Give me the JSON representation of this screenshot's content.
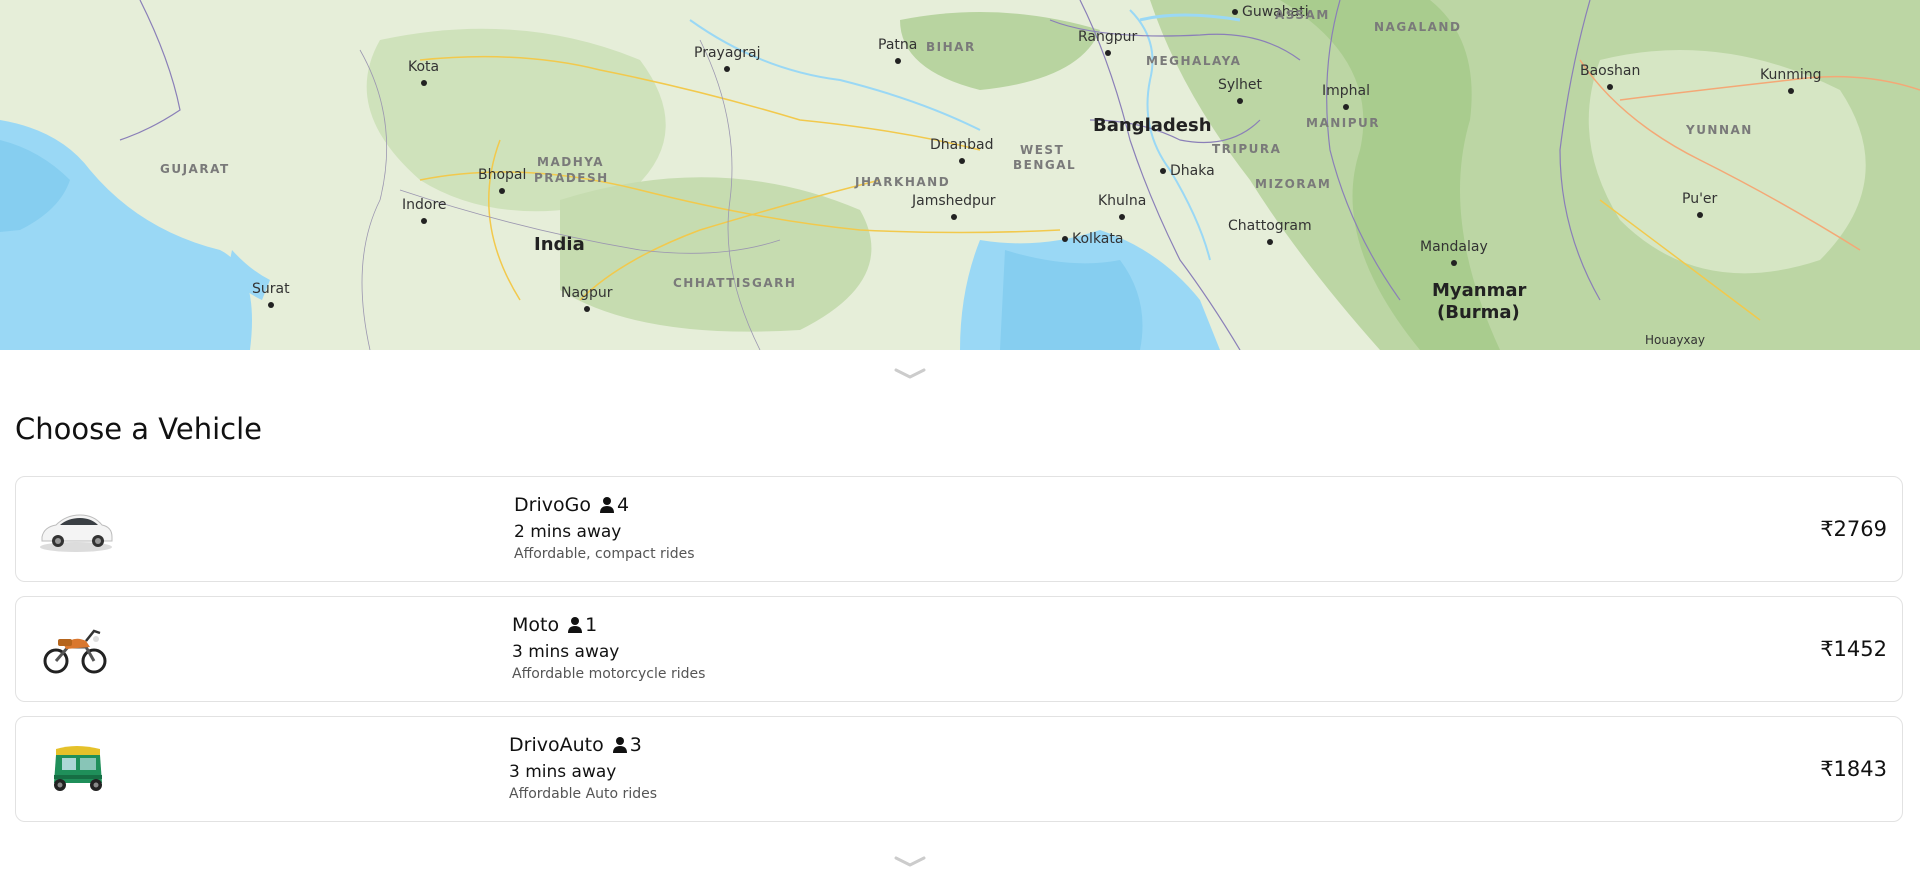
{
  "map": {
    "cities": [
      {
        "name": "Kota"
      },
      {
        "name": "Prayagraj"
      },
      {
        "name": "Patna"
      },
      {
        "name": "Rangpur"
      },
      {
        "name": "Guwahati"
      },
      {
        "name": "Bhopal"
      },
      {
        "name": "Indore"
      },
      {
        "name": "Dhanbad"
      },
      {
        "name": "Jamshedpur"
      },
      {
        "name": "Kolkata"
      },
      {
        "name": "Khulna"
      },
      {
        "name": "Dhaka"
      },
      {
        "name": "Sylhet"
      },
      {
        "name": "Imphal"
      },
      {
        "name": "Chattogram"
      },
      {
        "name": "Baoshan"
      },
      {
        "name": "Kunming"
      },
      {
        "name": "Pu'er"
      },
      {
        "name": "Mandalay"
      },
      {
        "name": "Surat"
      },
      {
        "name": "Nagpur"
      },
      {
        "name": "Houayxay"
      }
    ],
    "regions": [
      {
        "name": "GUJARAT"
      },
      {
        "name": "MADHYA"
      },
      {
        "name": "PRADESH"
      },
      {
        "name": "BIHAR"
      },
      {
        "name": "JHARKHAND"
      },
      {
        "name": "WEST"
      },
      {
        "name": "BENGAL"
      },
      {
        "name": "CHHATTISGARH"
      },
      {
        "name": "MEGHALAYA"
      },
      {
        "name": "ASSAM"
      },
      {
        "name": "NAGALAND"
      },
      {
        "name": "MANIPUR"
      },
      {
        "name": "TRIPURA"
      },
      {
        "name": "MIZORAM"
      },
      {
        "name": "YUNNAN"
      }
    ],
    "countries": [
      {
        "name": "India"
      },
      {
        "name": "Bangladesh"
      },
      {
        "name": "Myanmar"
      },
      {
        "name": "(Burma)"
      }
    ],
    "colors": {
      "land": "#e6eed9",
      "forest": "#c8deb4",
      "water": "#9ad8f5",
      "roads": "#f2c94c",
      "borders": "#8a7fb8"
    }
  },
  "panel": {
    "title": "Choose a Vehicle",
    "handle_icon": "chevron-down-icon"
  },
  "vehicles": [
    {
      "name": "DrivoGo",
      "seats": "4",
      "eta": "2 mins away",
      "description": "Affordable, compact rides",
      "price": "₹2769",
      "icon": "car-icon"
    },
    {
      "name": "Moto",
      "seats": "1",
      "eta": "3 mins away",
      "description": "Affordable motorcycle rides",
      "price": "₹1452",
      "icon": "motorcycle-icon"
    },
    {
      "name": "DrivoAuto",
      "seats": "3",
      "eta": "3 mins away",
      "description": "Affordable Auto rides",
      "price": "₹1843",
      "icon": "auto-rickshaw-icon"
    }
  ]
}
